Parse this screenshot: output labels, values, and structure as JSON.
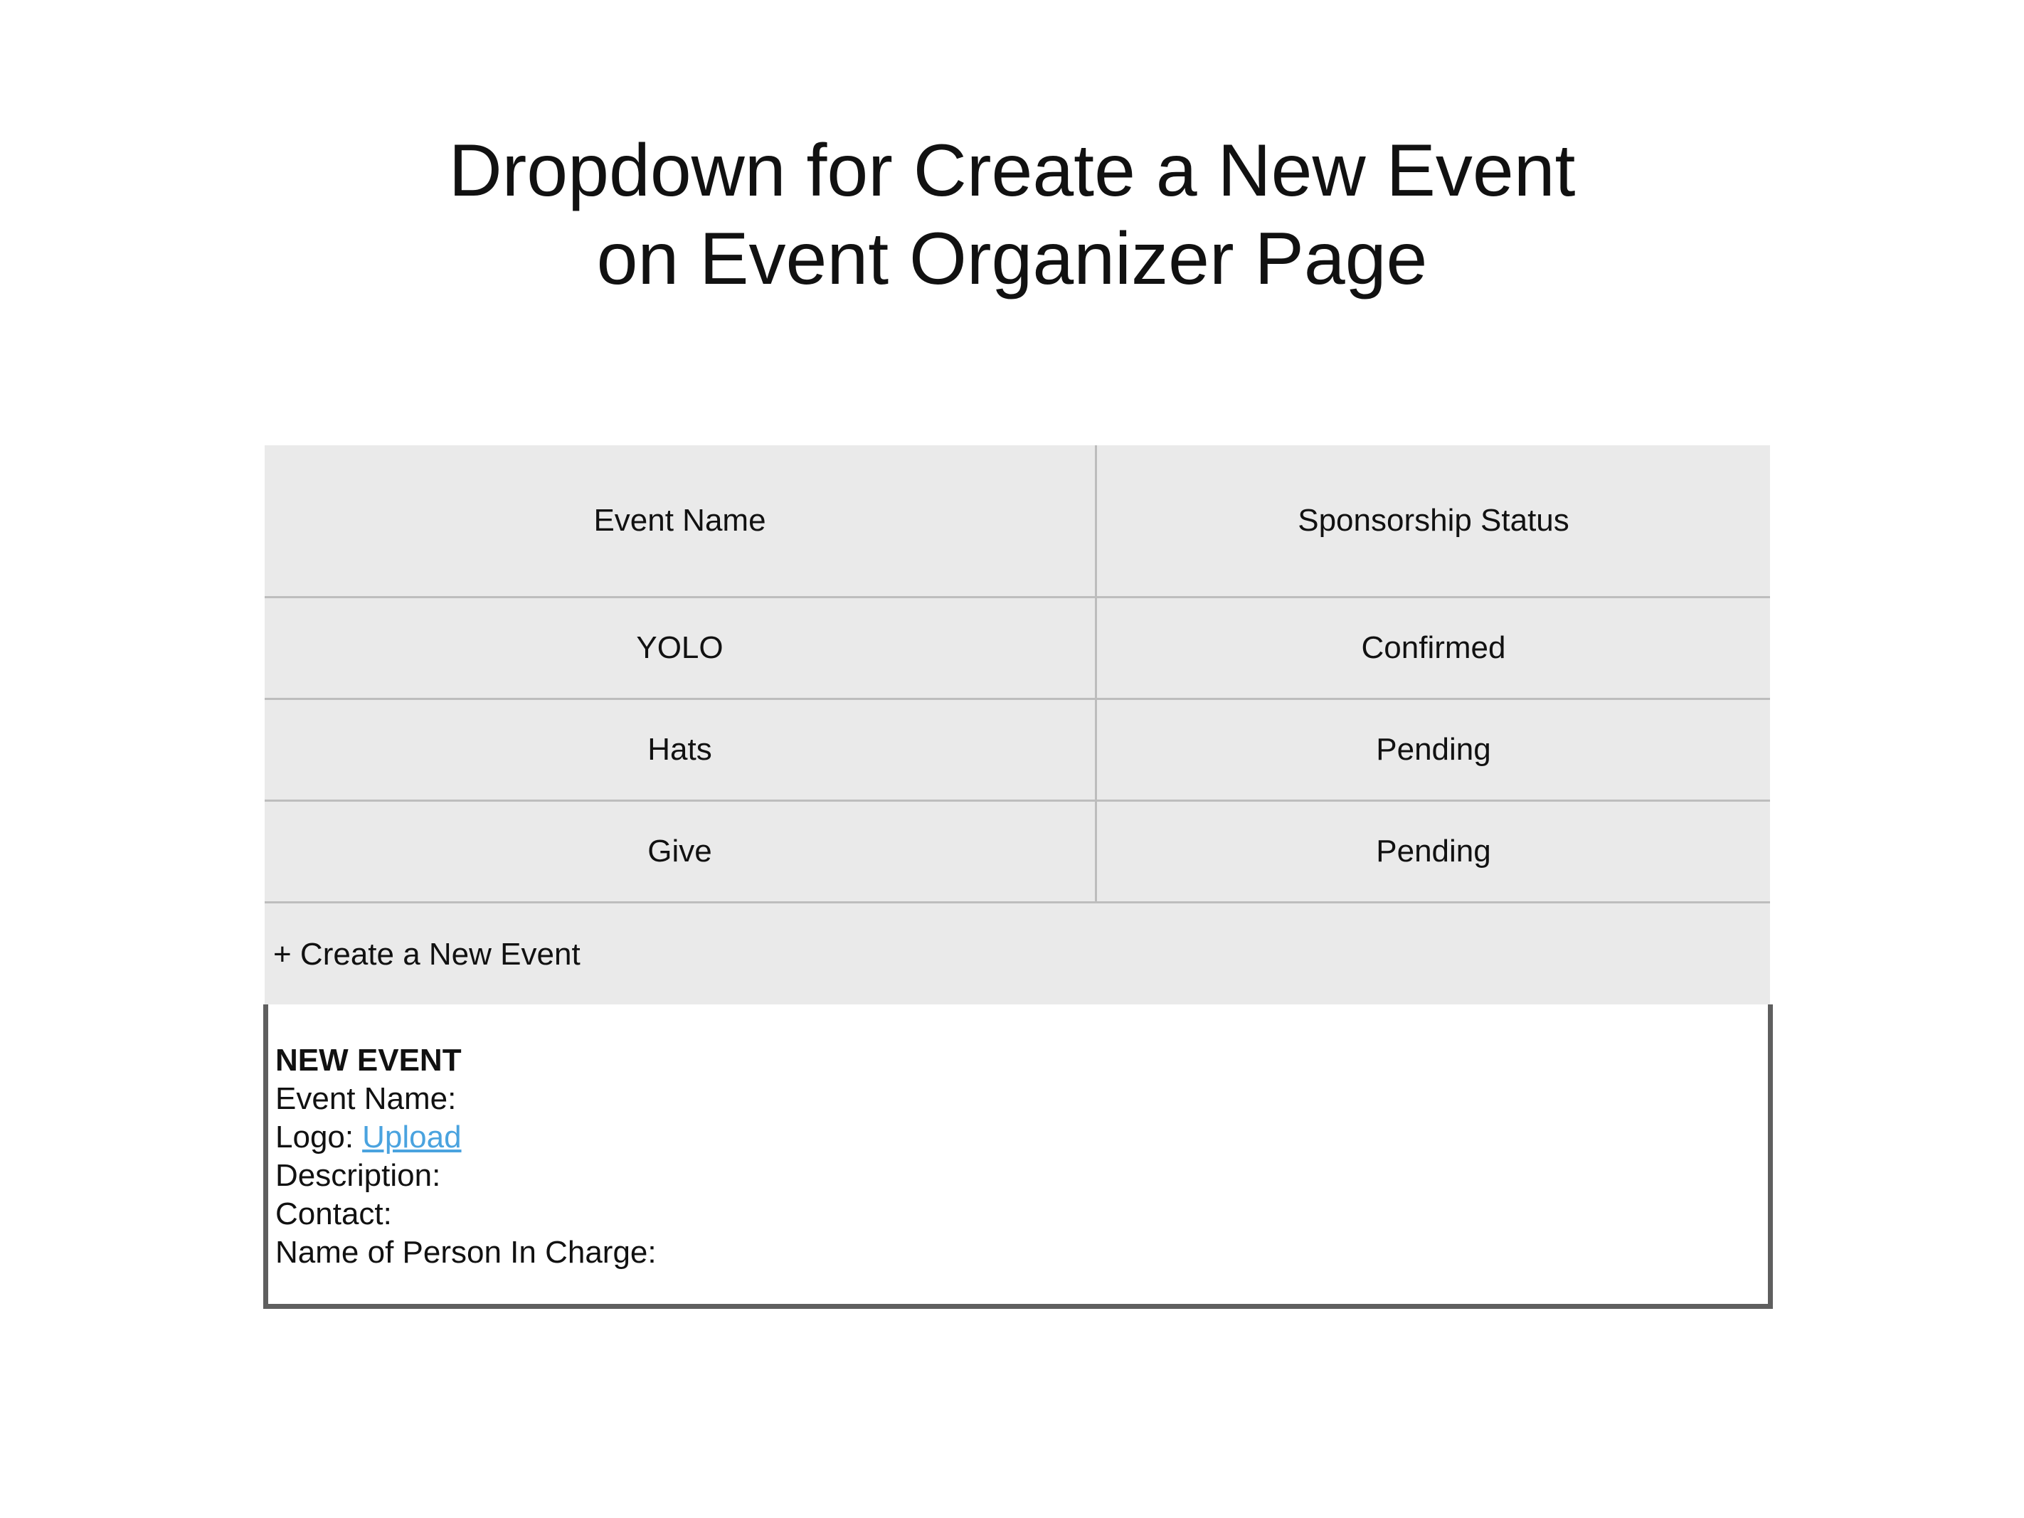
{
  "title": {
    "line1": "Dropdown for Create a New Event",
    "line2": "on Event Organizer Page"
  },
  "table": {
    "headers": {
      "event_name": "Event Name",
      "sponsorship_status": "Sponsorship Status"
    },
    "rows": [
      {
        "event_name": "YOLO",
        "status": "Confirmed"
      },
      {
        "event_name": "Hats",
        "status": "Pending"
      },
      {
        "event_name": "Give",
        "status": "Pending"
      }
    ],
    "create_label": "+ Create a New Event"
  },
  "new_event_form": {
    "heading": "NEW EVENT",
    "event_name_label": "Event Name:",
    "logo_label": "Logo:",
    "upload_link": "Upload",
    "description_label": "Description:",
    "contact_label": "Contact:",
    "person_in_charge_label": "Name of Person In Charge:"
  },
  "colors": {
    "table_background": "#eaeaea",
    "grid_lines": "#bdbdbd",
    "form_border": "#5f5f5f",
    "link": "#4aa3df"
  }
}
